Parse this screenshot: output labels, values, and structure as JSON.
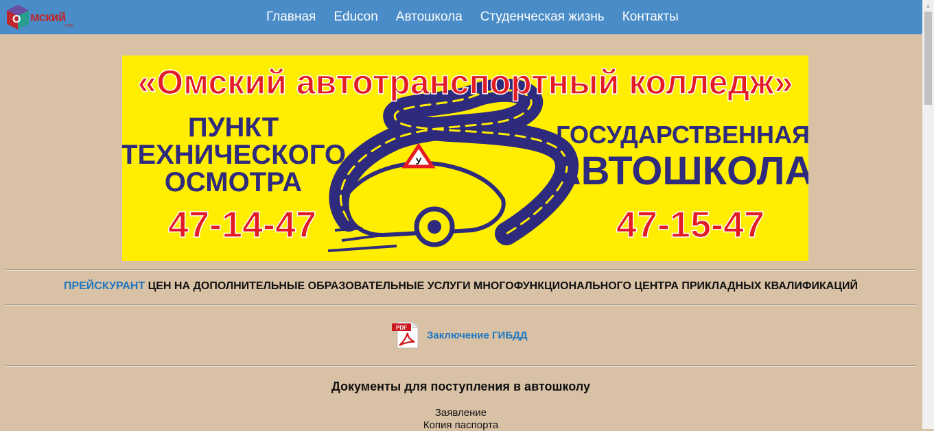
{
  "header": {
    "logo_text": "мский",
    "logo_sub": "ОАТК",
    "nav": [
      "Главная",
      "Educon",
      "Автошкола",
      "Студенческая жизнь",
      "Контакты"
    ]
  },
  "banner": {
    "title": "«Омский автотранспортный колледж»",
    "left_lines": [
      "ПУНКТ",
      "ТЕХНИЧЕСКОГО",
      "ОСМОТРА"
    ],
    "left_phone": "47-14-47",
    "right_line1": "ГОСУДАРСТВЕННАЯ",
    "right_line2": "АВТОШКОЛА",
    "right_phone": "47-15-47",
    "sign_letter": "У"
  },
  "price": {
    "link": "ПРЕЙСКУРАНТ",
    "text": " ЦЕН НА ДОПОЛНИТЕЛЬНЫЕ ОБРАЗОВАТЕЛЬНЫЕ УСЛУГИ МНОГОФУНКЦИОНАЛЬНОГО ЦЕНТРА ПРИКЛАДНЫХ КВАЛИФИКАЦИЙ"
  },
  "pdf": {
    "badge": "PDF",
    "link": "Заключение ГИБДД"
  },
  "docs": {
    "title": "Документы для поступления в автошколу",
    "items": [
      "Заявление",
      "Копия паспорта"
    ]
  },
  "colors": {
    "page_bg": "#d9c1a5",
    "header_bg": "#4a8cc7",
    "link": "#1e77c2",
    "banner_yellow": "#ffee00",
    "banner_red": "#e31b23",
    "banner_navy": "#2e2a7d"
  }
}
